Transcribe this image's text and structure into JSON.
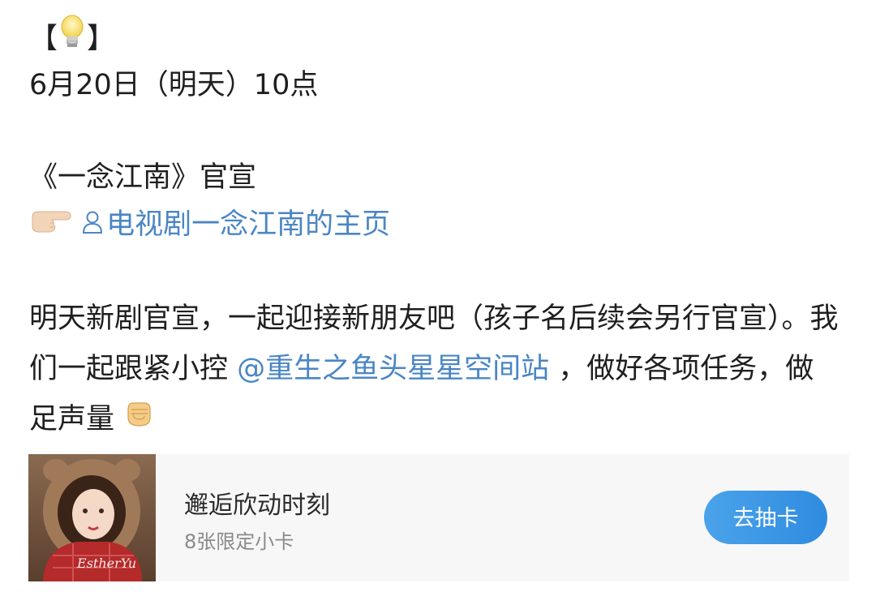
{
  "post": {
    "bracket_open": "【",
    "bracket_close": "】",
    "datetime": "6月20日（明天）10点",
    "show_title": "《一念江南》官宣",
    "homepage_link": "电视剧一念江南的主页",
    "body_part1": "明天新剧官宣，一起迎接新朋友吧（孩子名后续会另行官宣）。我们一起跟紧小控 ",
    "mention": "@重生之鱼头星星空间站",
    "body_part2": " ，做好各项任务，做足声量",
    "icons": {
      "lightbulb": "lightbulb-icon",
      "pointing_hand": "pointing-right-icon",
      "user": "user-outline-icon",
      "fist": "raised-fist-icon"
    }
  },
  "card": {
    "title": "邂逅欣动时刻",
    "subtitle": "8张限定小卡",
    "button_label": "去抽卡",
    "thumb_signature": "EstherYu",
    "accent_color": "#3a96e6"
  }
}
